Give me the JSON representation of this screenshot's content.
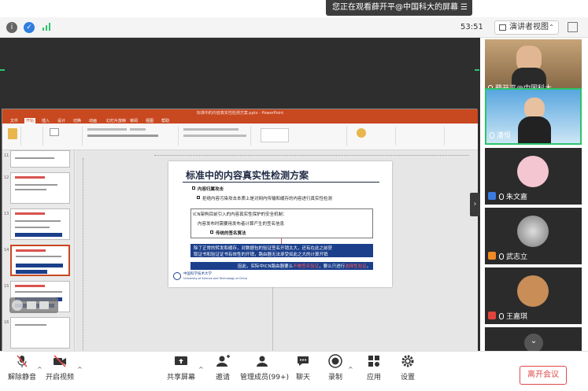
{
  "banner": {
    "text": "您正在观看薛开平@中国科大的屏幕",
    "icon": "list-icon"
  },
  "topbar": {
    "timer": "53:51",
    "view_label": "演讲者视图",
    "view_caret": "⌃"
  },
  "ppt": {
    "window_title": "标准中的内容真实性检测方案.pptx - PowerPoint",
    "tabs": [
      "文件",
      "开始",
      "插入",
      "设计",
      "切换",
      "动画",
      "幻灯片放映",
      "审阅",
      "视图",
      "帮助"
    ],
    "thumb_numbers": [
      "11",
      "12",
      "13",
      "14",
      "15",
      "16"
    ]
  },
  "slide": {
    "title": "标准中的内容真实性检测方案",
    "l1": "内容归属攻击",
    "l2": "拒绝内容污染攻击本质上是对网内传输和缓存的内容进行真实性检测",
    "l3": "ICN架构目前引入的内容真实性保护的安全机制：",
    "l4": "内容发布时需要用发布者计算产生的签名信息",
    "l5": "传统的签名算法",
    "b1": "除了正常的转发和缓存，对数据包的验证签名开销太大，还有在此之前获",
    "b2": "取证书和验证证书有效性的开销，路由器无法承受如此之大的计算开销",
    "b3a": "因此，实际中ICN路由器要么",
    "b3b": "不做签名验证",
    "b3c": "，要么只进行",
    "b3d": "选择性验证",
    "b3e": "。",
    "logo_cn": "中国科学技术大学",
    "logo_en": "University of Science and Technology of China"
  },
  "participants": [
    {
      "name": "薛开平@中国科大",
      "active": false,
      "avatar_color": "#8a6a48"
    },
    {
      "name": "潘恒",
      "active": true,
      "avatar_color": "#7fb3d9"
    },
    {
      "name": "朱文嘉",
      "active": false,
      "avatar_color": "#f3c6d1",
      "tag_color": "#3b7be0"
    },
    {
      "name": "武志立",
      "active": false,
      "avatar_color": "#cfcfcf",
      "tag_color": "#f08a24"
    },
    {
      "name": "王嘉琪",
      "active": false,
      "avatar_color": "#c98d57",
      "tag_color": "#e0443b"
    }
  ],
  "bottom": {
    "mute": "解除静音",
    "video": "开启视频",
    "share": "共享屏幕",
    "invite": "邀请",
    "members": "管理成员(99+)",
    "chat": "聊天",
    "record": "录制",
    "apps": "应用",
    "settings": "设置",
    "leave": "离开会议"
  },
  "colors": {
    "accent_green": "#2bc46b",
    "ppt_red": "#c84820",
    "slide_blue": "#1b3f8b",
    "leave_red": "#e04b4b"
  }
}
